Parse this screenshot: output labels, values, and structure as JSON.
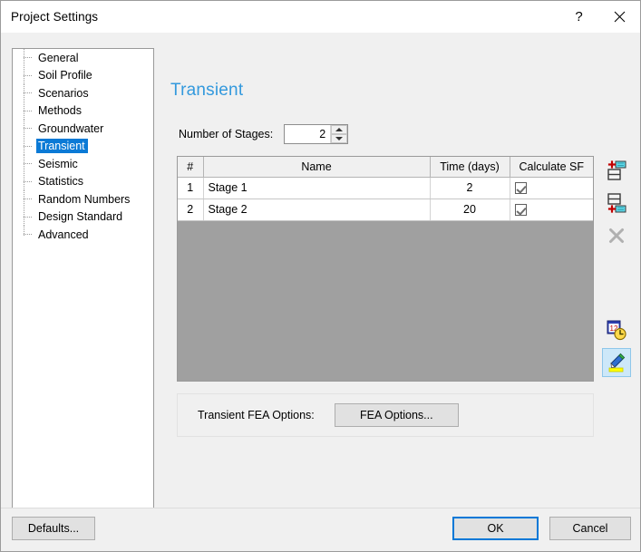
{
  "window": {
    "title": "Project Settings",
    "help_label": "?",
    "close_label": "✕"
  },
  "sidebar": {
    "items": [
      {
        "label": "General",
        "selected": false
      },
      {
        "label": "Soil Profile",
        "selected": false
      },
      {
        "label": "Scenarios",
        "selected": false
      },
      {
        "label": "Methods",
        "selected": false
      },
      {
        "label": "Groundwater",
        "selected": false
      },
      {
        "label": "Transient",
        "selected": true
      },
      {
        "label": "Seismic",
        "selected": false
      },
      {
        "label": "Statistics",
        "selected": false
      },
      {
        "label": "Random Numbers",
        "selected": false
      },
      {
        "label": "Design Standard",
        "selected": false
      },
      {
        "label": "Advanced",
        "selected": false
      }
    ]
  },
  "pane": {
    "heading": "Transient",
    "heading_color": "#3399dd",
    "stages": {
      "label": "Number of Stages:",
      "value": "2"
    },
    "grid": {
      "headers": [
        "#",
        "Name",
        "Time (days)",
        "Calculate SF"
      ],
      "rows": [
        {
          "num": "1",
          "name": "Stage 1",
          "time": "2",
          "sf_checked": true
        },
        {
          "num": "2",
          "name": "Stage 2",
          "time": "20",
          "sf_checked": true
        }
      ]
    },
    "toolbar": [
      {
        "name": "insert-row-above-icon",
        "enabled": true,
        "active": false
      },
      {
        "name": "insert-row-below-icon",
        "enabled": true,
        "active": false
      },
      {
        "name": "delete-row-icon",
        "enabled": false,
        "active": false
      },
      {
        "name": "stage-time-settings-icon",
        "enabled": true,
        "active": false
      },
      {
        "name": "highlighter-icon",
        "enabled": true,
        "active": true
      }
    ],
    "fea": {
      "label": "Transient FEA Options:",
      "button_label": "FEA Options..."
    }
  },
  "footer": {
    "defaults_label": "Defaults...",
    "ok_label": "OK",
    "cancel_label": "Cancel"
  },
  "colors": {
    "selection": "#0b7ad6",
    "accent": "#0078d7",
    "dialog_bg": "#f0f0f0",
    "grid_empty": "#a0a0a0"
  }
}
